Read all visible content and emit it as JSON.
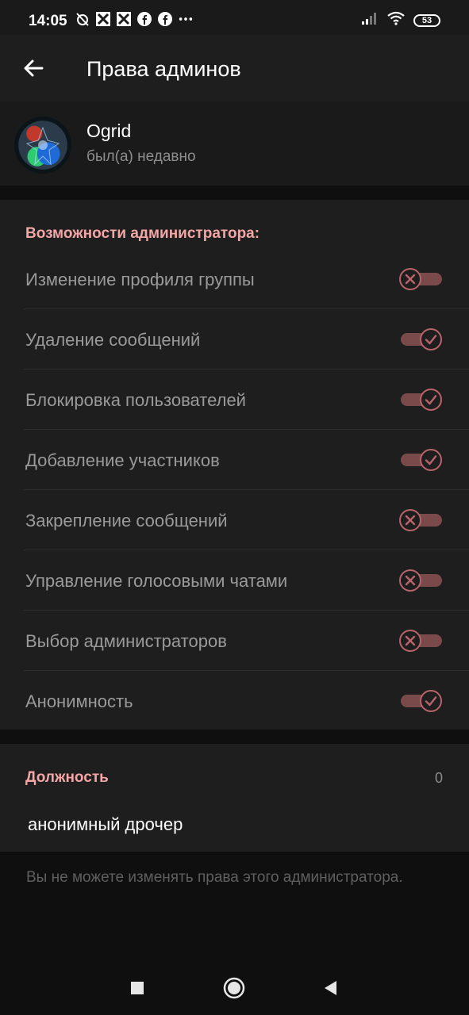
{
  "status_bar": {
    "time": "14:05",
    "battery": "53",
    "icons": [
      "alarm-off-icon",
      "app-icon",
      "app-icon",
      "facebook-icon",
      "facebook-icon",
      "more-icon",
      "signal-icon",
      "wifi-icon"
    ]
  },
  "app_bar": {
    "title": "Права админов",
    "back_icon": "arrow-left-icon"
  },
  "profile": {
    "name": "Ogrid",
    "status": "был(а) недавно"
  },
  "permissions": {
    "header": "Возможности администратора:",
    "items": [
      {
        "label": "Изменение профиля группы",
        "enabled": false
      },
      {
        "label": "Удаление сообщений",
        "enabled": true
      },
      {
        "label": "Блокировка пользователей",
        "enabled": true
      },
      {
        "label": "Добавление участников",
        "enabled": true
      },
      {
        "label": "Закрепление сообщений",
        "enabled": false
      },
      {
        "label": "Управление голосовыми чатами",
        "enabled": false
      },
      {
        "label": "Выбор администраторов",
        "enabled": false
      },
      {
        "label": "Анонимность",
        "enabled": true
      }
    ]
  },
  "position": {
    "header": "Должность",
    "count": "0",
    "value": "анонимный дрочер"
  },
  "footer_note": "Вы не можете изменять права этого администратора.",
  "colors": {
    "accent": "#f2a6a6",
    "switch_track": "#7a4a4a",
    "switch_knob_border": "#b8646a",
    "background": "#1e1e1e"
  }
}
